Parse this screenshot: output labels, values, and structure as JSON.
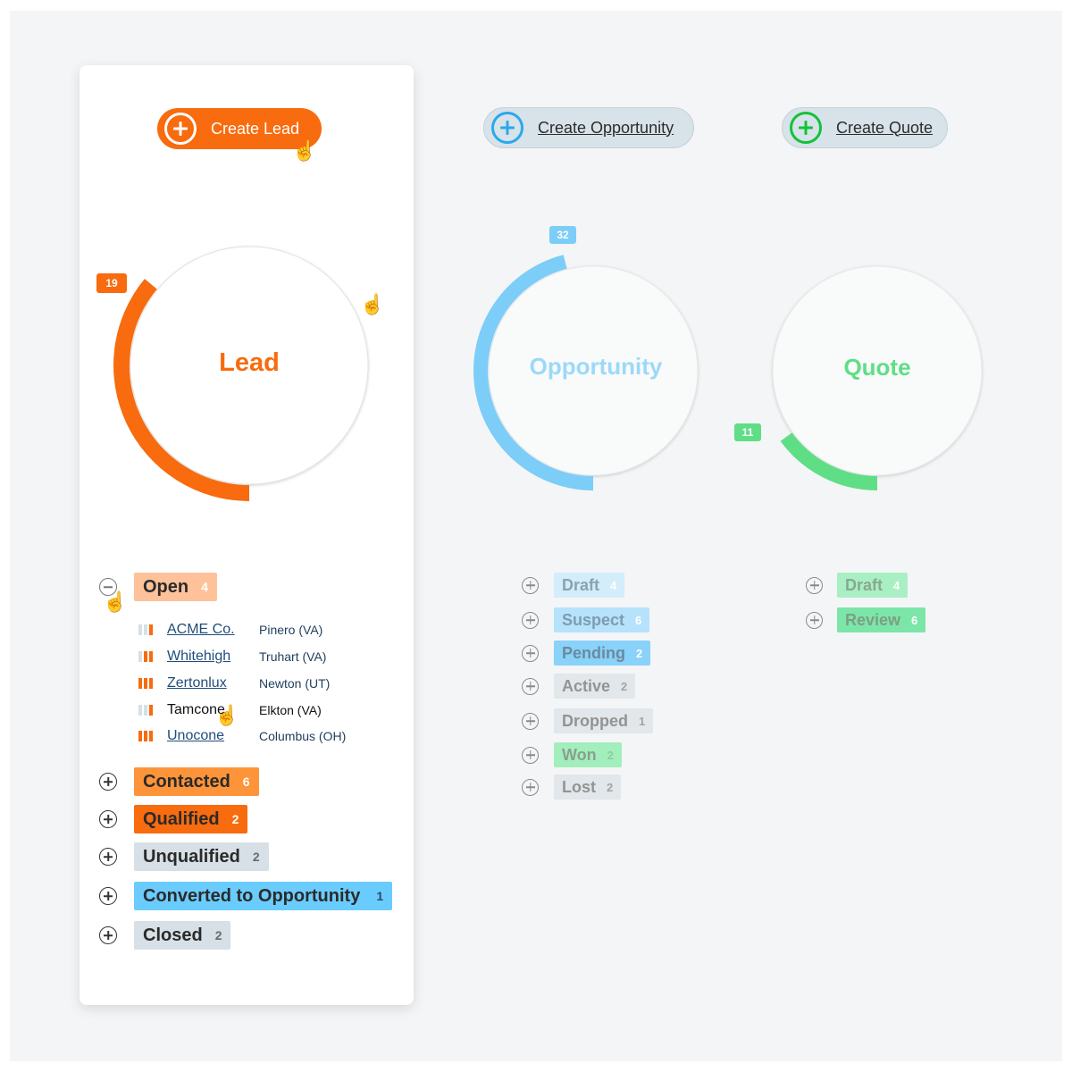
{
  "buttons": {
    "create_lead": "Create Lead",
    "create_opportunity": "Create Opportunity",
    "create_quote": "Create Quote"
  },
  "colors": {
    "lead": "#f86b0e",
    "opportunity": "#7ccdf8",
    "quote": "#5fde86",
    "grey_tag": "#d6e0e6"
  },
  "lead": {
    "title": "Lead",
    "count": "19",
    "fill_fraction": 0.36,
    "statuses": [
      {
        "label": "Open",
        "count": "4",
        "expanded": true
      },
      {
        "label": "Contacted",
        "count": "6"
      },
      {
        "label": "Qualified",
        "count": "2"
      },
      {
        "label": "Unqualified",
        "count": "2"
      },
      {
        "label": "Converted to Opportunity",
        "count": "1"
      },
      {
        "label": "Closed",
        "count": "2"
      }
    ],
    "open_accounts": [
      {
        "name": "ACME Co.",
        "location": "Pinero (VA)",
        "level": 1
      },
      {
        "name": "Whitehigh",
        "location": "Truhart (VA)",
        "level": 2
      },
      {
        "name": "Zertonlux",
        "location": "Newton (UT)",
        "level": 3
      },
      {
        "name": "Tamcone",
        "location": "Elkton (VA)",
        "level": 1
      },
      {
        "name": "Unocone",
        "location": "Columbus (OH)",
        "level": 3
      }
    ]
  },
  "opportunity": {
    "title": "Opportunity",
    "count": "32",
    "fill_fraction": 0.46,
    "statuses": [
      {
        "label": "Draft",
        "count": "4"
      },
      {
        "label": "Suspect",
        "count": "6"
      },
      {
        "label": "Pending",
        "count": "2"
      },
      {
        "label": "Active",
        "count": "2"
      },
      {
        "label": "Dropped",
        "count": "1"
      },
      {
        "label": "Won",
        "count": "2"
      },
      {
        "label": "Lost",
        "count": "2"
      }
    ]
  },
  "quote": {
    "title": "Quote",
    "count": "11",
    "fill_fraction": 0.15,
    "statuses": [
      {
        "label": "Draft",
        "count": "4"
      },
      {
        "label": "Review",
        "count": "6"
      }
    ]
  }
}
